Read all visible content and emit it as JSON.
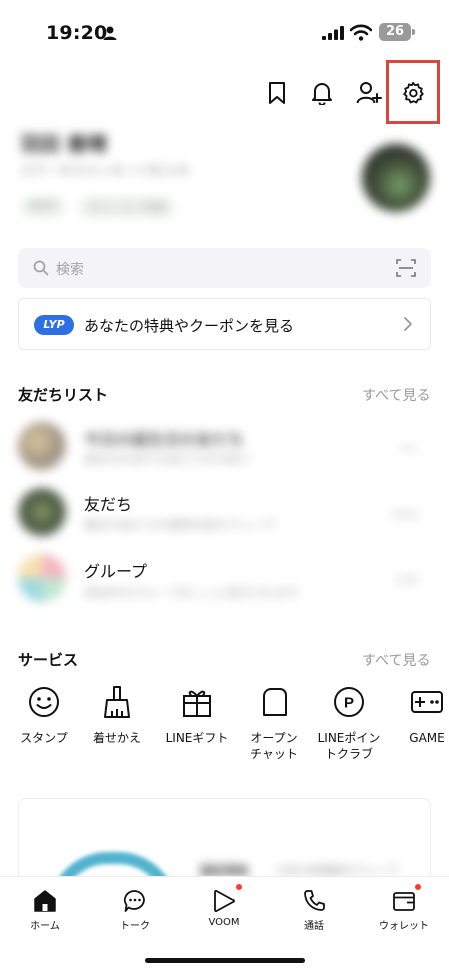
{
  "status_bar": {
    "time": "19:20",
    "battery": "26"
  },
  "header": {
    "icons": [
      "bookmark-icon",
      "bell-icon",
      "add-friend-icon",
      "gear-icon"
    ],
    "highlight_color": "#d9463b"
  },
  "profile": {
    "name": "羽田 善晴",
    "status_message": "ステータスメッセージを入力",
    "tags": [
      "BGM",
      "ストーリー作成"
    ]
  },
  "search": {
    "placeholder": "検索"
  },
  "banner": {
    "badge": "LYP",
    "text": "あなたの特典やクーポンを見る",
    "badge_color": "#2f6fe4"
  },
  "friends_section": {
    "title": "友だちリスト",
    "see_all": "すべて見る",
    "rows": [
      {
        "title": "今日の誕生日の友だち",
        "subtitle": "誕生日を迎える友だちをお祝い",
        "meta": "3人"
      },
      {
        "title": "友だち",
        "subtitle": "最近の友だちの更新内容をチェック",
        "meta": "100人"
      },
      {
        "title": "グループ",
        "subtitle": "参加中のグループがここに表示されます",
        "meta": "12件"
      }
    ]
  },
  "services_section": {
    "title": "サービス",
    "see_all": "すべて見る",
    "items": [
      {
        "label": "スタンプ",
        "icon": "smiley-icon"
      },
      {
        "label": "着せかえ",
        "icon": "brush-icon"
      },
      {
        "label": "LINEギフト",
        "icon": "gift-icon"
      },
      {
        "label": "オープン\nチャット",
        "icon": "open-chat-icon"
      },
      {
        "label": "LINEポイン\nトクラブ",
        "icon": "points-icon"
      },
      {
        "label": "GAME",
        "icon": "gamepad-icon"
      }
    ]
  },
  "card": {
    "title": "最新情報",
    "subtitle": "LINEの新機能をチェック"
  },
  "tabbar": {
    "tabs": [
      {
        "label": "ホーム",
        "icon": "home-icon",
        "active": true
      },
      {
        "label": "トーク",
        "icon": "chat-icon"
      },
      {
        "label": "VOOM",
        "icon": "voom-icon",
        "badge": true
      },
      {
        "label": "通話",
        "icon": "phone-icon"
      },
      {
        "label": "ウォレット",
        "icon": "wallet-icon",
        "badge": true
      }
    ]
  }
}
